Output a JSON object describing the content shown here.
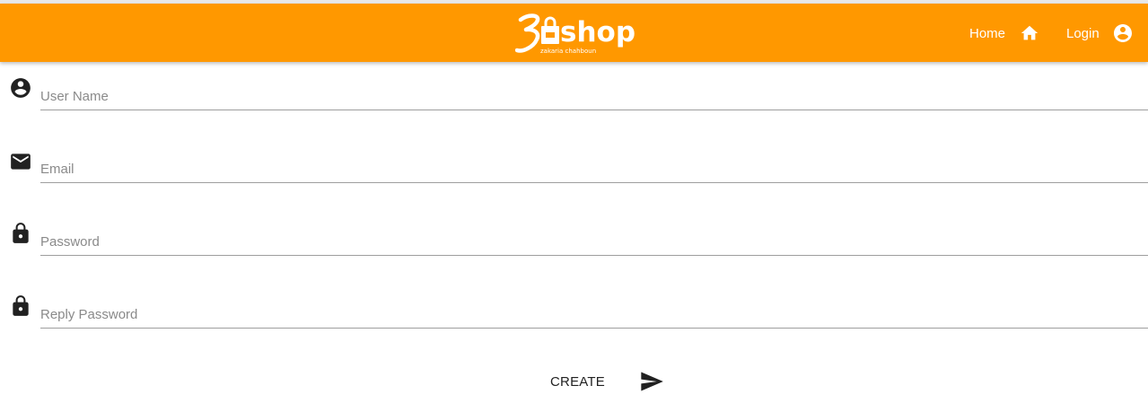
{
  "header": {
    "brand_word": "shop",
    "brand_sub": "zakaria chahboun",
    "brand_color": "#ff9800",
    "nav": [
      {
        "label": "Home",
        "icon": "home-icon"
      },
      {
        "label": "Login",
        "icon": "account-circle-icon"
      }
    ]
  },
  "form": {
    "fields": [
      {
        "placeholder": "User Name",
        "icon": "account-circle-icon",
        "type": "text"
      },
      {
        "placeholder": "Email",
        "icon": "email-icon",
        "type": "email"
      },
      {
        "placeholder": "Password",
        "icon": "lock-icon",
        "type": "password"
      },
      {
        "placeholder": "Reply Password",
        "icon": "lock-icon",
        "type": "password"
      }
    ],
    "submit": {
      "label": "CREATE",
      "icon": "send-icon"
    }
  }
}
